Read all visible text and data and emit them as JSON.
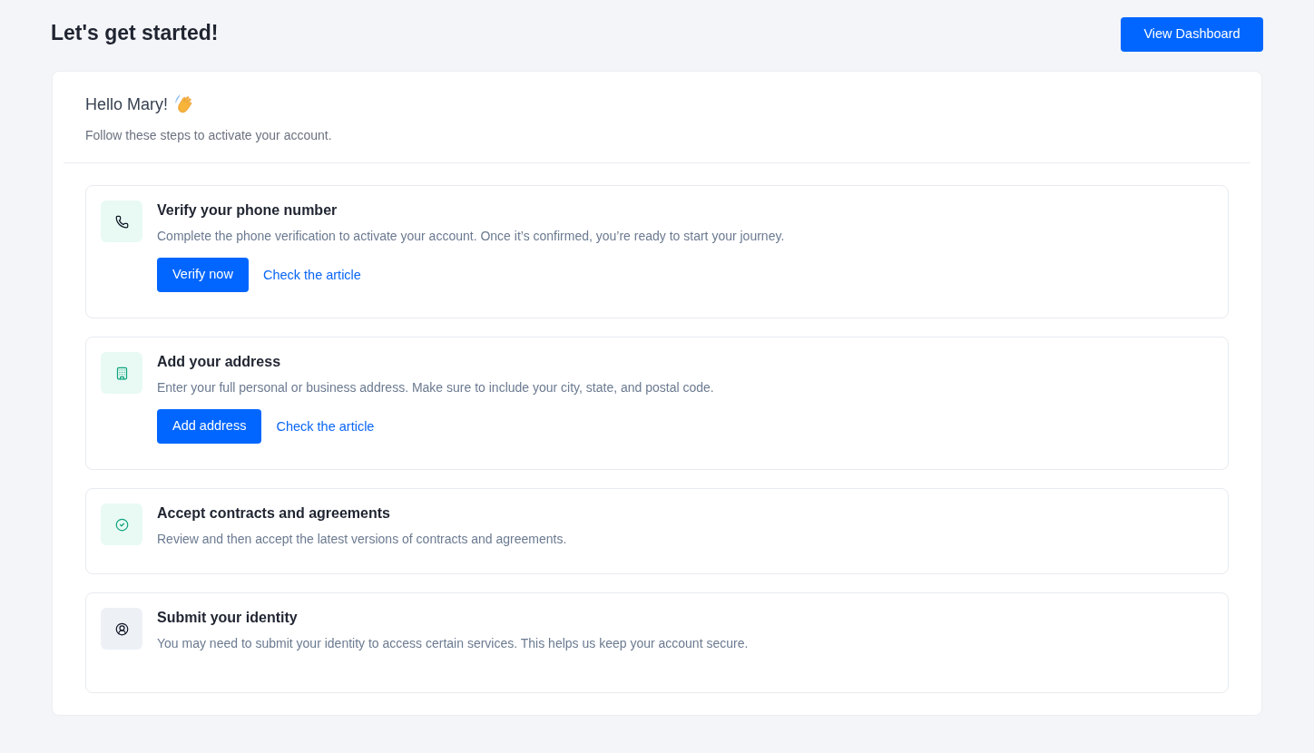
{
  "header": {
    "title": "Let's get started!",
    "button": "View Dashboard"
  },
  "intro": {
    "greeting": "Hello Mary!",
    "subtitle": "Follow these steps to activate your account."
  },
  "steps": [
    {
      "kind": "phone",
      "color": "#e8faf3",
      "title": "Verify your phone number",
      "description": "Complete the phone verification to activate your account. Once it’s confirmed, you’re ready to start your journey.",
      "action": "Verify now",
      "link": "Check the article"
    },
    {
      "kind": "building",
      "color": "#e8faf3",
      "title": "Add your address",
      "description": "Enter your full personal or business address. Make sure to include your city, state, and postal code.",
      "action": "Add address",
      "link": "Check the article"
    },
    {
      "kind": "check",
      "color": "#e8faf3",
      "title": "Accept contracts and agreements",
      "description": "Review and then accept the latest versions of contracts and agreements."
    },
    {
      "kind": "user",
      "color": "#edf1f6",
      "title": "Submit your identity",
      "description": "You may need to submit your identity to access certain services. This helps us keep your account secure."
    }
  ]
}
